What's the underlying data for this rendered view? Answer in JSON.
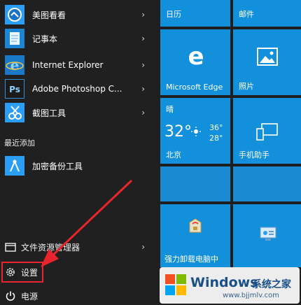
{
  "start_menu": {
    "apps": [
      {
        "label": "美图看看",
        "icon": "meitu-viewer-icon",
        "has_arrow": true
      },
      {
        "label": "记事本",
        "icon": "notepad-icon",
        "has_arrow": true
      },
      {
        "label": "Internet Explorer",
        "icon": "internet-explorer-icon",
        "has_arrow": true
      },
      {
        "label": "Adobe Photoshop C...",
        "icon": "photoshop-icon",
        "has_arrow": true
      },
      {
        "label": "截图工具",
        "icon": "snipping-tool-icon",
        "has_arrow": true
      }
    ],
    "recently_added_header": "最近添加",
    "recent_apps": [
      {
        "label": "加密备份工具",
        "icon": "backup-tool-icon"
      }
    ],
    "bottom": {
      "file_explorer": "文件资源管理器",
      "settings": "设置",
      "power": "电源"
    }
  },
  "tiles": {
    "calendar": "日历",
    "mail": "邮件",
    "edge": "Microsoft Edge",
    "photos": "照片",
    "weather": {
      "condition": "晴",
      "temp": "32°",
      "high": "36°",
      "low": "28°",
      "city": "北京"
    },
    "phone_companion": "手机助手",
    "tool_tile_text": "强力卸载电脑中",
    "control_panel_tile": ""
  },
  "watermark": {
    "brand": "Windows",
    "site_name": "系统之家",
    "url": "www.bjjmlv.com"
  },
  "colors": {
    "tile_blue": "#1390dc",
    "annotation_red": "#e8242c",
    "menu_bg": "#202020"
  }
}
